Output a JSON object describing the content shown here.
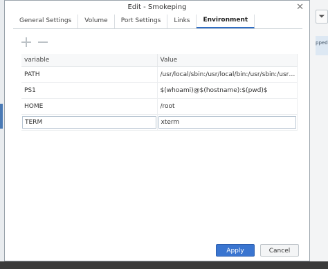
{
  "dialog": {
    "title": "Edit - Smokeping",
    "close_label": "✕"
  },
  "tabs": [
    {
      "label": "General Settings"
    },
    {
      "label": "Volume"
    },
    {
      "label": "Port Settings"
    },
    {
      "label": "Links"
    },
    {
      "label": "Environment",
      "active": true
    }
  ],
  "toolbar": {
    "add_icon": "plus-icon",
    "remove_icon": "minus-icon"
  },
  "table": {
    "headers": [
      "variable",
      "Value"
    ],
    "rows": [
      {
        "variable": "PATH",
        "value": "/usr/local/sbin:/usr/local/bin:/usr/sbin:/usr/bin:/sbin:/bin"
      },
      {
        "variable": "PS1",
        "value": "$(whoami)@$(hostname):$(pwd)$"
      },
      {
        "variable": "HOME",
        "value": "/root"
      },
      {
        "variable": "TERM",
        "value": "xterm"
      }
    ]
  },
  "footer": {
    "apply_label": "Apply",
    "cancel_label": "Cancel"
  },
  "background": {
    "filter_icon": "filter-icon",
    "snippet_text": "pped"
  },
  "colors": {
    "accent": "#3a75d0",
    "active_tab_underline": "#2f6cc2"
  }
}
